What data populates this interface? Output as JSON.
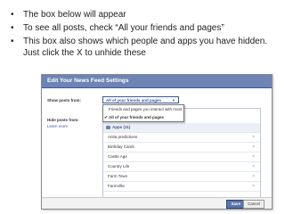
{
  "bullets": [
    "The box below will appear",
    "To see all posts, check “All your friends and pages”",
    "This box also shows which people and apps you have hidden. Just click the X to unhide these"
  ],
  "dialog": {
    "title": "Edit Your News Feed Settings",
    "show_posts_label": "Show posts from:",
    "hide_posts_label": "Hide posts from:",
    "learn_more": "Learn more",
    "select_value": "All of your friends and pages",
    "dropdown_options": [
      "Friends and pages you interact with most",
      "All of your friends and pages"
    ],
    "apps_group": "Apps (11)",
    "items": [
      "Anita predictions",
      "Birthday Cards",
      "Castle Age",
      "Country Life",
      "Farm Town",
      "FarmVille"
    ],
    "remove_glyph": "×",
    "save_label": "Save",
    "cancel_label": "Cancel"
  }
}
